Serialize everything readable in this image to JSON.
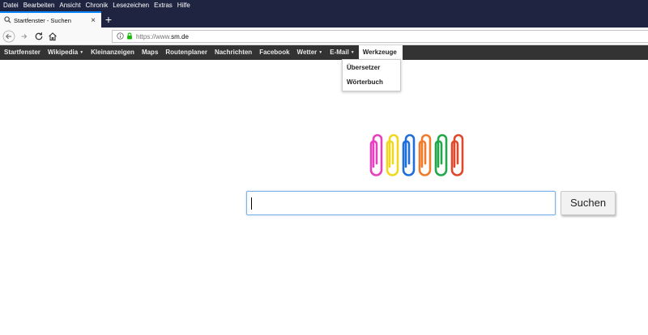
{
  "menubar": {
    "items": [
      "Datei",
      "Bearbeiten",
      "Ansicht",
      "Chronik",
      "Lesezeichen",
      "Extras",
      "Hilfe"
    ]
  },
  "tab": {
    "title": "Startfenster - Suchen",
    "close": "×",
    "new_tab": "+"
  },
  "urlbar": {
    "prefix": "https://www.",
    "domain": "sm.de"
  },
  "sitenav": {
    "items": [
      "Startfenster",
      "Wikipedia",
      "Kleinanzeigen",
      "Maps",
      "Routenplaner",
      "Nachrichten",
      "Facebook",
      "Wetter",
      "E-Mail",
      "Werkzeuge"
    ],
    "caret": "▼"
  },
  "dropdown": {
    "items": [
      "Übersetzer",
      "Wörterbuch"
    ]
  },
  "logo": {
    "clip_colors": [
      "#e83fbf",
      "#f0d820",
      "#1e6fd9",
      "#f07b2a",
      "#22a84a",
      "#e0482c"
    ]
  },
  "search": {
    "placeholder": "",
    "button_label": "Suchen"
  }
}
